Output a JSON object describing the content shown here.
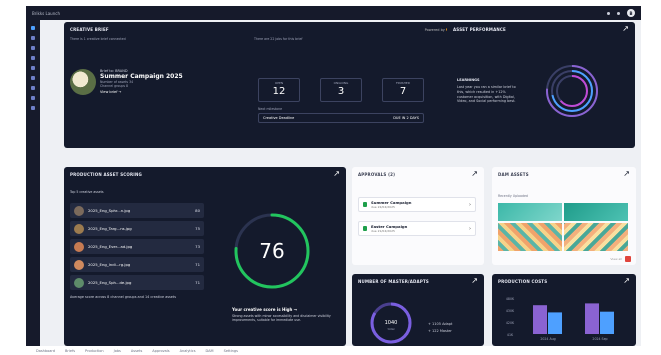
{
  "window": {
    "title": "Brikks Launch"
  },
  "brief": {
    "title": "CREATIVE BRIEF",
    "powered_prefix": "Powered by",
    "powered_brand": "dice",
    "connected_text": "There is 1 creative brief connected",
    "jobs_text": "There are 22 jobs for this brief",
    "owner": "Brief to: BRAND",
    "campaign": "Summer Campaign 2025",
    "assets_line": "Number of assets 34",
    "channels_line": "Channel groups 8",
    "view_link": "View brief →",
    "kpis": [
      {
        "label": "OPEN",
        "value": "12"
      },
      {
        "label": "ONGOING",
        "value": "3"
      },
      {
        "label": "FINISHED",
        "value": "7"
      }
    ],
    "milestones_label": "Next milestone",
    "milestone_name": "Creative Deadline",
    "milestone_due": "DUE IN 2 DAYS"
  },
  "performance": {
    "title": "ASSET PERFORMANCE",
    "learnings_label": "LEARNINGS",
    "text": "Last year you ran a similar brief to this, which resulted in +12% customer acquisition, with Digital, Video, and Social performing best."
  },
  "scoring": {
    "title": "PRODUCTION ASSET SCORING",
    "subtitle": "Top 5 creative assets",
    "assets": [
      {
        "name": "2025_Eng_Sphr...n.jpg",
        "score": "80"
      },
      {
        "name": "2025_Eng_Targ...ns.jpg",
        "score": "75"
      },
      {
        "name": "2025_Eng_Ever...ad.jpg",
        "score": "73"
      },
      {
        "name": "2025_Eng_Indi...rg.jpg",
        "score": "71"
      },
      {
        "name": "2025_Eng_Sph...de.jpg",
        "score": "71"
      }
    ],
    "average_text": "Average score across 8 channel groups and 14 creative assets",
    "gauge_value": "76",
    "gauge_fraction": 0.76,
    "verdict": "Your creative score is High →",
    "verdict_detail": "Strong assets with minor accessibility and disclaimer visibility improvements, suitable for immediate use."
  },
  "approvals": {
    "title": "APPROVALS (2)",
    "items": [
      {
        "name": "Summer Campaign",
        "due": "due 22/04/2025"
      },
      {
        "name": "Easter Campaign",
        "due": "due 21/04/2025"
      }
    ]
  },
  "dam": {
    "title": "DAM ASSETS",
    "subtitle": "Recently Uploaded",
    "view_all": "View all"
  },
  "masteradapts": {
    "title": "NUMBER OF MASTER/ADAPTS",
    "total": "1040",
    "total_label": "total",
    "legend": [
      "+ 1105 Adapt",
      "+ 122 Master"
    ]
  },
  "costs": {
    "title": "PRODUCTION COSTS"
  },
  "chart_data": {
    "type": "bar",
    "categories": [
      "2024 Aug",
      "2024 Sep"
    ],
    "series": [
      {
        "values": [
          4000,
          4250
        ]
      },
      {
        "values": [
          3000,
          3100
        ]
      }
    ],
    "ytick_labels": [
      "480K",
      "430K",
      "420K",
      "41K"
    ],
    "ylim": [
      0,
      5000
    ],
    "colors": [
      "#8a63d2",
      "#4ea0ff"
    ]
  },
  "taskbar": {
    "items": [
      "Dashboard",
      "Briefs",
      "Production",
      "Jobs",
      "Assets",
      "Approvals",
      "Analytics",
      "DAM",
      "Settings"
    ]
  }
}
